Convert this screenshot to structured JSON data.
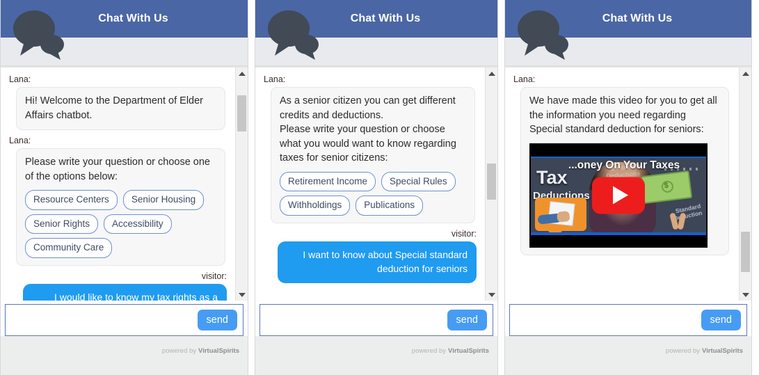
{
  "header": {
    "title": "Chat With Us",
    "icon": "speech-bubbles-icon",
    "bar_color": "#4a66a5"
  },
  "composer": {
    "value": "",
    "placeholder": "",
    "send_label": "send"
  },
  "footer": {
    "powered_text": "powered by",
    "brand": "VirtualSpirits"
  },
  "labels": {
    "bot_name": "Lana:",
    "visitor_name": "visitor:"
  },
  "panels": [
    {
      "messages": [
        {
          "sender": "Lana:",
          "type": "bot",
          "text": "Hi! Welcome to the Department of Elder Affairs chatbot.",
          "options": []
        },
        {
          "sender": "Lana:",
          "type": "bot",
          "text": "Please write your question or choose one of the options below:",
          "options": [
            "Resource Centers",
            "Senior Housing",
            "Senior Rights",
            "Accessibility",
            "Community Care"
          ]
        },
        {
          "sender": "visitor:",
          "type": "visitor",
          "text": "I would like to know my tax rights as a senior citizen"
        }
      ],
      "scroll_thumb_top_pct": 6,
      "scroll_thumb_height_pct": 16
    },
    {
      "messages": [
        {
          "sender": "Lana:",
          "type": "bot",
          "text": "As a senior citizen you can get different credits and deductions.\nPlease write your question or choose what you would want to know regarding taxes for senior citizens:",
          "options": [
            "Retirement Income",
            "Special Rules",
            "Withholdings",
            "Publications"
          ]
        },
        {
          "sender": "visitor:",
          "type": "visitor",
          "text": "I want to know about Special standard deduction for seniors"
        }
      ],
      "scroll_thumb_top_pct": 42,
      "scroll_thumb_height_pct": 16
    },
    {
      "messages": [
        {
          "sender": "Lana:",
          "type": "bot",
          "text": "We have made this video for you to get all the information you need regarding Special standard deduction for seniors:",
          "options": [],
          "has_video": true
        }
      ],
      "scroll_thumb_top_pct": 72,
      "scroll_thumb_height_pct": 18
    }
  ],
  "video": {
    "title": "...oney On Your Taxes",
    "word_tax": "Tax",
    "word_deductions": "Deductions",
    "ghost_label": "Medical\nDeductions",
    "standard_label": "Standard\nDeduction",
    "bill_symbol": "$",
    "play_button": "play-button-icon",
    "play_color": "#ee1d1d"
  }
}
